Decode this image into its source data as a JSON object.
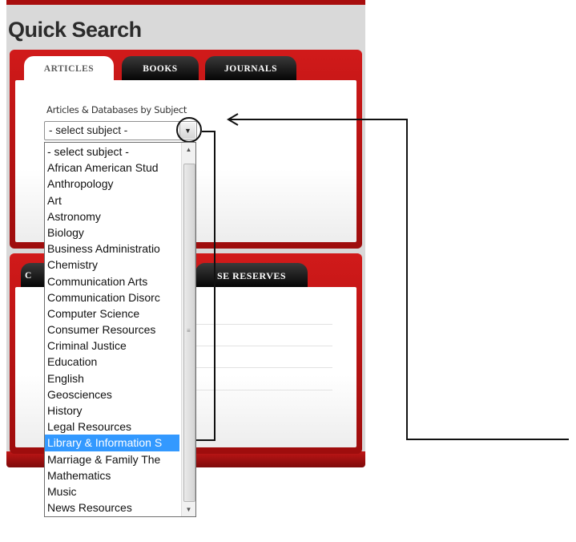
{
  "title": "Quick Search",
  "tabs_top": [
    {
      "label": "ARTICLES",
      "active": true
    },
    {
      "label": "BOOKS",
      "active": false
    },
    {
      "label": "JOURNALS",
      "active": false
    }
  ],
  "subject_label": "Articles & Databases by Subject",
  "select": {
    "value": "- select subject -"
  },
  "dropdown_items": [
    "- select subject -",
    "African American Stud",
    "Anthropology",
    "Art",
    "Astronomy",
    "Biology",
    "Business Administratio",
    "Chemistry",
    "Communication Arts",
    "Communication Disorc",
    "Computer Science",
    "Consumer Resources",
    "Criminal Justice",
    "Education",
    "English",
    "Geosciences",
    "History",
    "Legal Resources",
    "Library & Information S",
    "Marriage & Family The",
    "Mathematics",
    "Music",
    "News Resources"
  ],
  "highlighted_item": "Library & Information S",
  "tabs_bottom": [
    {
      "label": "C",
      "active": false
    },
    {
      "label": "SE RESERVES",
      "active": false
    }
  ],
  "colors": {
    "brand_red": "#c01616",
    "highlight": "#3399ff"
  }
}
